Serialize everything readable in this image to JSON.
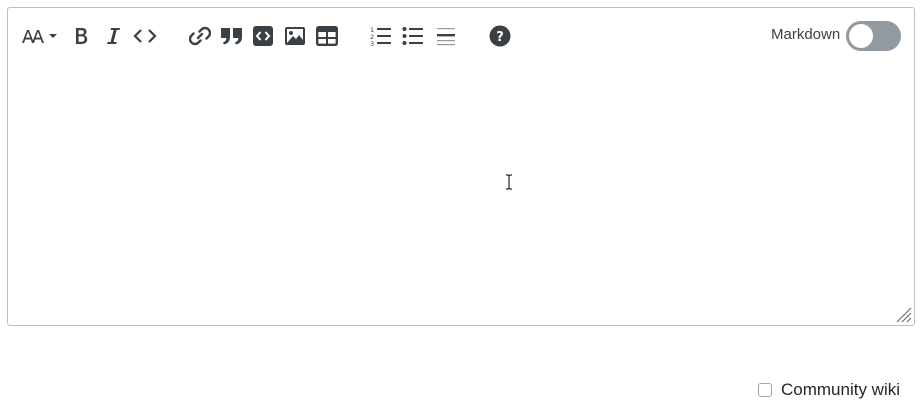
{
  "toolbar": {
    "buttons": [
      {
        "name": "heading-icon",
        "title": "Heading"
      },
      {
        "name": "bold-icon",
        "title": "Bold"
      },
      {
        "name": "italic-icon",
        "title": "Italic"
      },
      {
        "name": "code-icon",
        "title": "Code"
      },
      {
        "name": "link-icon",
        "title": "Link"
      },
      {
        "name": "blockquote-icon",
        "title": "Blockquote"
      },
      {
        "name": "code-block-icon",
        "title": "Code block"
      },
      {
        "name": "image-icon",
        "title": "Image"
      },
      {
        "name": "table-icon",
        "title": "Table"
      },
      {
        "name": "ordered-list-icon",
        "title": "Numbered list"
      },
      {
        "name": "bullet-list-icon",
        "title": "Bulleted list"
      },
      {
        "name": "horizontal-rule-icon",
        "title": "Horizontal rule"
      },
      {
        "name": "help-icon",
        "title": "Help"
      }
    ],
    "markdown_label": "Markdown",
    "markdown_enabled": false
  },
  "editor": {
    "content": ""
  },
  "options": {
    "community_wiki_label": "Community wiki",
    "community_wiki_checked": false
  },
  "colors": {
    "icon": "#3b4045",
    "border": "#babfc4",
    "toggle_off": "#9199a1"
  }
}
